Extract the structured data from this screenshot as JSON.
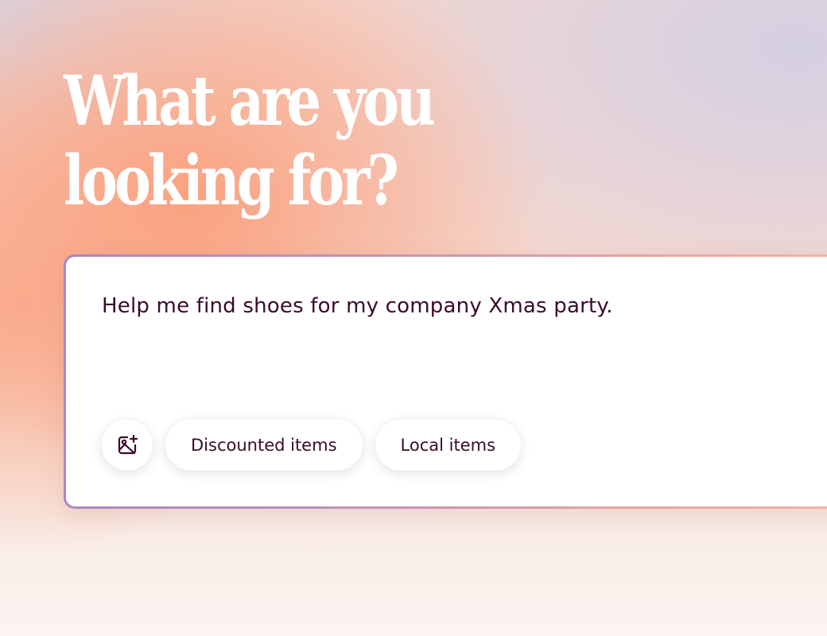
{
  "headline": {
    "line1": "What are you",
    "line2": "looking for?"
  },
  "search": {
    "query": "Help me find shoes for my company Xmas party.",
    "image_button_icon": "add-image-icon"
  },
  "chips": [
    {
      "label": "Discounted items"
    },
    {
      "label": "Local items"
    }
  ],
  "colors": {
    "text": "#3b0a2a",
    "headline": "#ffffff",
    "border_start": "#a987c4",
    "border_end": "#f2b7a4"
  }
}
